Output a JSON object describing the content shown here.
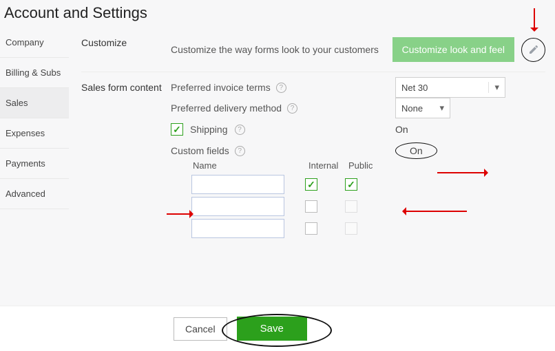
{
  "page_title": "Account and Settings",
  "sidebar": {
    "items": [
      {
        "label": "Company"
      },
      {
        "label": "Billing & Subs"
      },
      {
        "label": "Sales"
      },
      {
        "label": "Expenses"
      },
      {
        "label": "Payments"
      },
      {
        "label": "Advanced"
      }
    ],
    "active_index": 2
  },
  "customize": {
    "section_label": "Customize",
    "description": "Customize the way forms look to your customers",
    "button_label": "Customize look and feel"
  },
  "sales_form": {
    "section_label": "Sales form content",
    "invoice_terms": {
      "label": "Preferred invoice terms",
      "value": "Net 30"
    },
    "delivery_method": {
      "label": "Preferred delivery method",
      "value": "None"
    },
    "shipping": {
      "label": "Shipping",
      "checked": true,
      "status": "On"
    },
    "custom_fields": {
      "label": "Custom fields",
      "status": "On",
      "columns": {
        "name": "Name",
        "internal": "Internal",
        "public": "Public"
      },
      "rows": [
        {
          "name": "",
          "internal": true,
          "public": true
        },
        {
          "name": "",
          "internal": false,
          "public": false
        },
        {
          "name": "",
          "internal": false,
          "public": false
        }
      ]
    }
  },
  "footer": {
    "cancel": "Cancel",
    "save": "Save"
  }
}
